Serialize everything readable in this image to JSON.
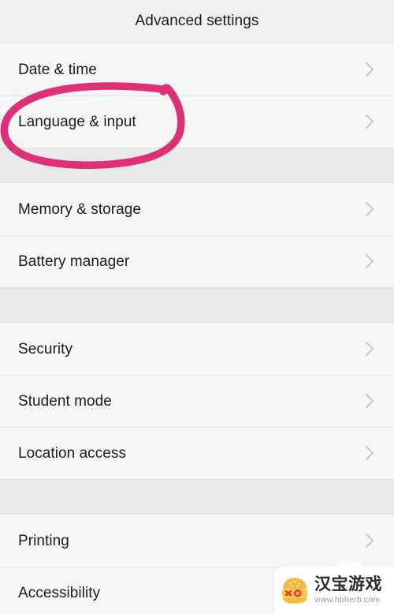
{
  "header": {
    "title": "Advanced settings"
  },
  "colors": {
    "page_background": "#f5f5f5",
    "header_background": "#f0f0f0",
    "row_background": "#f6f6f6",
    "section_spacer": "#e9e9e9",
    "divider": "#e6e6e6",
    "text": "#1c1c1c",
    "chevron": "#c3c3c3",
    "annotation_pink": "#dd3077",
    "watermark_logo_orange": "#f7b63a",
    "watermark_logo_red": "#e8412d"
  },
  "sections": [
    {
      "id": "section-1",
      "rows": [
        {
          "label": "Date & time",
          "name": "date-and-time",
          "chevron": "chevron-right-icon"
        },
        {
          "label": "Language & input",
          "name": "language-and-input",
          "chevron": "chevron-right-icon"
        }
      ]
    },
    {
      "id": "section-2",
      "rows": [
        {
          "label": "Memory & storage",
          "name": "memory-and-storage",
          "chevron": "chevron-right-icon"
        },
        {
          "label": "Battery manager",
          "name": "battery-manager",
          "chevron": "chevron-right-icon"
        }
      ]
    },
    {
      "id": "section-3",
      "rows": [
        {
          "label": "Security",
          "name": "security",
          "chevron": "chevron-right-icon"
        },
        {
          "label": "Student mode",
          "name": "student-mode",
          "chevron": "chevron-right-icon"
        },
        {
          "label": "Location access",
          "name": "location-access",
          "chevron": "chevron-right-icon"
        }
      ]
    },
    {
      "id": "section-4",
      "rows": [
        {
          "label": "Printing",
          "name": "printing",
          "chevron": "chevron-right-icon"
        },
        {
          "label": "Accessibility",
          "name": "accessibility",
          "chevron": "chevron-right-icon"
        }
      ]
    }
  ],
  "annotation": {
    "type": "hand-drawn-ellipse",
    "target": "Language & input",
    "color": "#dd3077",
    "stroke_width": 9
  },
  "watermark": {
    "brand": "汉宝游戏",
    "url": "www.hbherb.com",
    "logo": "burger-icon"
  }
}
